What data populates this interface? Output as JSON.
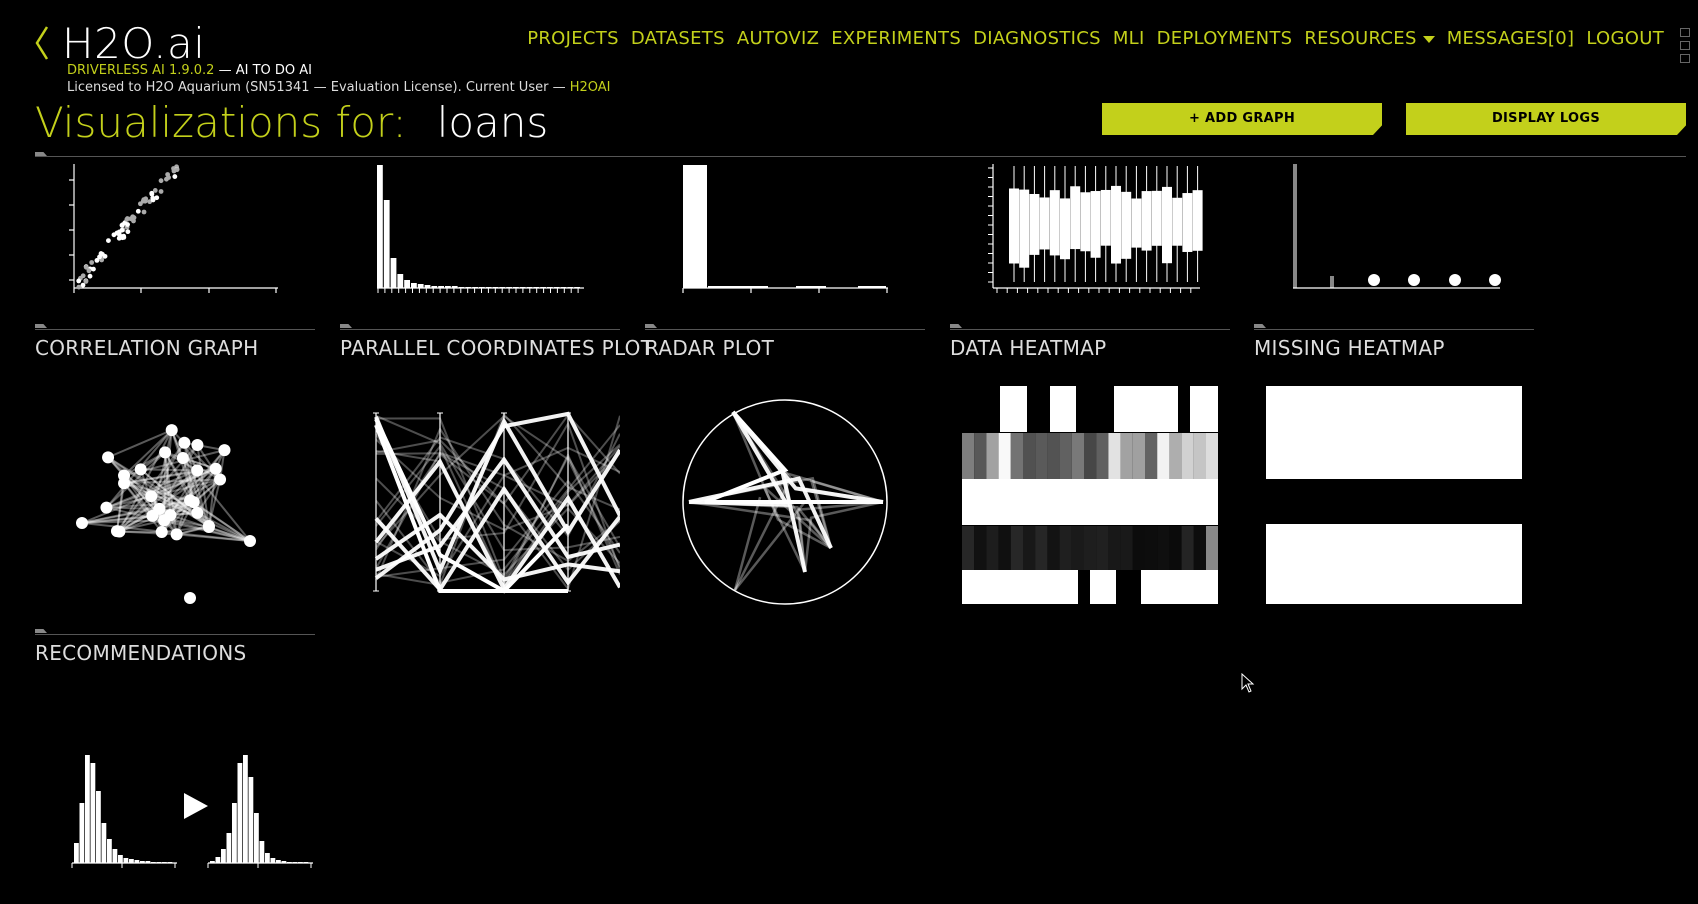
{
  "app": {
    "logo": "H2O.ai",
    "product": "DRIVERLESS AI 1.9.0.2",
    "tagline": " — AI TO DO AI",
    "license": "Licensed to H2O Aquarium (SN51341 — Evaluation License). Current User — ",
    "user": "H2OAI"
  },
  "nav": {
    "items": [
      "PROJECTS",
      "DATASETS",
      "AUTOVIZ",
      "EXPERIMENTS",
      "DIAGNOSTICS",
      "MLI",
      "DEPLOYMENTS",
      "RESOURCES",
      "MESSAGES[0]",
      "LOGOUT"
    ]
  },
  "page": {
    "title_prefix": "Visualizations for:",
    "dataset": "loans"
  },
  "toolbar": {
    "add_graph": "+ ADD GRAPH",
    "display_logs": "DISPLAY LOGS"
  },
  "graphs": {
    "row1_labels": [
      "CORRELATION GRAPH",
      "PARALLEL COORDINATES PLOT",
      "RADAR PLOT",
      "DATA HEATMAP",
      "MISSING HEATMAP"
    ],
    "row2_labels": [
      "RECOMMENDATIONS"
    ]
  },
  "colors": {
    "accent": "#c3d01b",
    "background": "#000000"
  },
  "icons": {
    "back": "chevron-left-icon",
    "menu": "grid-menu-icon",
    "cursor": "mouse-pointer-icon"
  }
}
